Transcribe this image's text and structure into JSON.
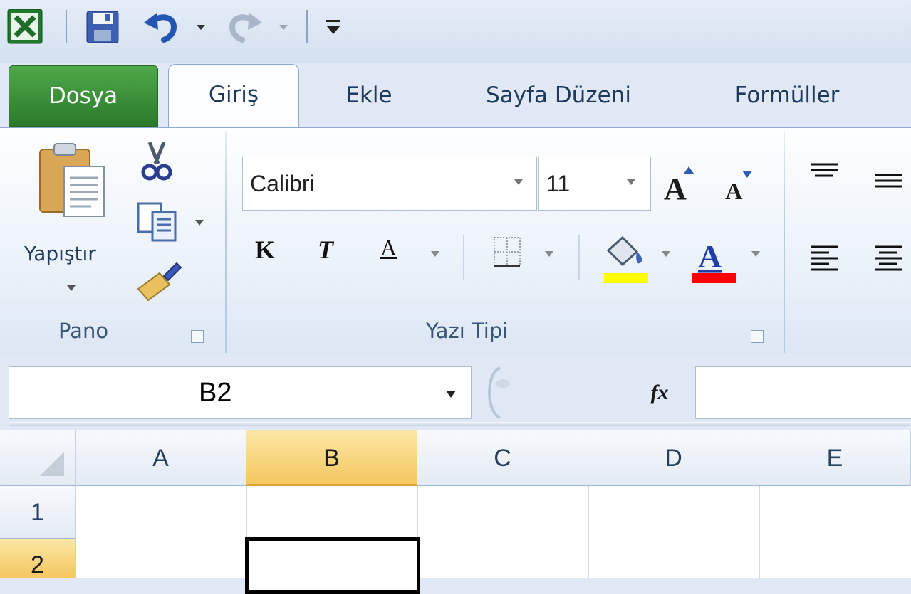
{
  "quick_access": {
    "icons": [
      "excel-icon",
      "save-icon",
      "undo-icon",
      "redo-icon",
      "customize-icon"
    ]
  },
  "tabs": {
    "file": "Dosya",
    "home": "Giriş",
    "insert": "Ekle",
    "page_layout": "Sayfa Düzeni",
    "formulas": "Formüller"
  },
  "ribbon": {
    "clipboard": {
      "label": "Pano",
      "paste_label": "Yapıştır"
    },
    "font": {
      "label": "Yazı Tipi",
      "font_name": "Calibri",
      "font_size": "11",
      "bold": "K",
      "italic": "T",
      "underline": "A",
      "fill_color": "#ffff00",
      "font_color": "#ff0000"
    }
  },
  "formula_bar": {
    "name_box": "B2",
    "fx_label": "fx",
    "formula": ""
  },
  "grid": {
    "columns": [
      "A",
      "B",
      "C",
      "D",
      "E"
    ],
    "rows": [
      "1",
      "2"
    ],
    "active_cell": "B2"
  }
}
